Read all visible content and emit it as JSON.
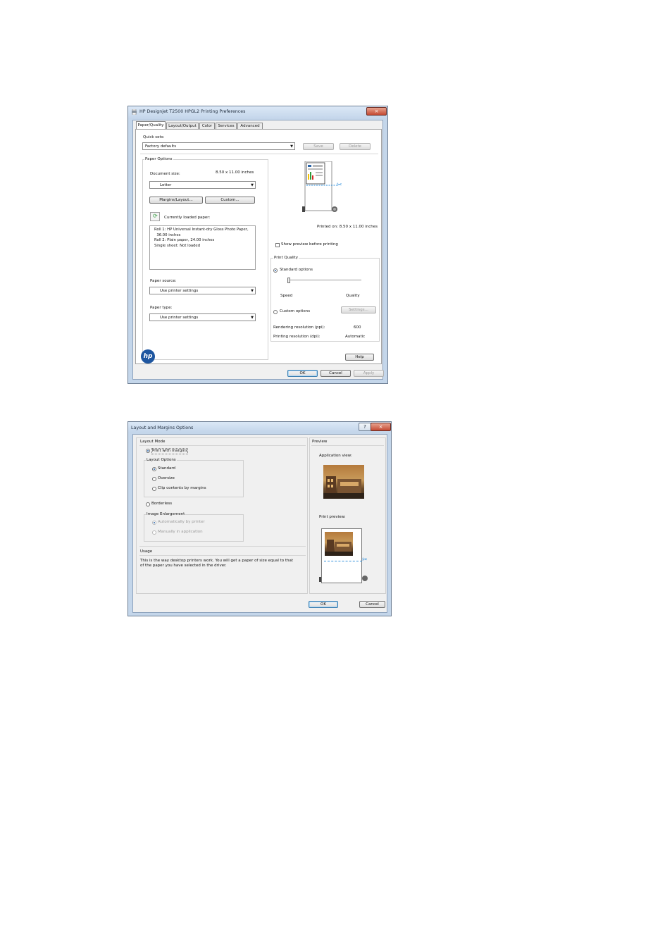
{
  "dialog1": {
    "title": "HP Designjet T2500 HPGL2 Printing Preferences",
    "close": "×",
    "tabs": [
      "Paper/Quality",
      "Layout/Output",
      "Color",
      "Services",
      "Advanced"
    ],
    "quick_sets": {
      "label": "Quick sets:",
      "value": "Factory defaults",
      "save": "Save",
      "delete": "Delete"
    },
    "paper_options": {
      "title": "Paper Options",
      "document_size_label": "Document size:",
      "document_size_value": "8.50 x 11.00 inches",
      "size_select": "Letter",
      "margins_button": "Margins/Layout...",
      "custom_button": "Custom...",
      "loaded_paper_label": "Currently loaded paper:",
      "loaded_paper_lines": [
        "Roll 1: HP Universal Instant-dry Gloss Photo Paper,",
        "  36.00 inches",
        "Roll 2: Plain paper, 24.00 inches",
        "Single sheet: Not loaded"
      ],
      "paper_source_label": "Paper source:",
      "paper_source_value": "Use printer settings",
      "paper_type_label": "Paper type:",
      "paper_type_value": "Use printer settings"
    },
    "preview": {
      "printed_on": "Printed on: 8.50 x 11.00 inches",
      "show_preview_label": "Show preview before printing"
    },
    "print_quality": {
      "title": "Print Quality",
      "standard_label": "Standard options",
      "speed": "Speed",
      "quality": "Quality",
      "custom_label": "Custom options",
      "settings_button": "Settings...",
      "rendering_label": "Rendering resolution (ppi):",
      "rendering_value": "600",
      "printing_label": "Printing resolution (dpi):",
      "printing_value": "Automatic"
    },
    "hp_logo": "hp",
    "help_button": "Help",
    "ok": "OK",
    "cancel": "Cancel",
    "apply": "Apply"
  },
  "dialog2": {
    "title": "Layout and Margins Options",
    "help": "?",
    "close": "×",
    "layout_mode_title": "Layout Mode",
    "print_with_margins": "Print with margins",
    "layout_options_title": "Layout Options",
    "standard": "Standard",
    "oversize": "Oversize",
    "clip_contents": "Clip contents by margins",
    "borderless": "Borderless",
    "image_enlargement_title": "Image Enlargement",
    "auto_by_printer": "Automatically by printer",
    "manually_in_app": "Manually in application",
    "usage_title": "Usage",
    "usage_text_1": "This is the way desktop printers work. You will get a paper of size equal to that",
    "usage_text_2": "of the paper you have selected in the driver.",
    "preview_title": "Preview",
    "application_view": "Application view:",
    "print_preview": "Print preview:",
    "ok": "OK",
    "cancel": "Cancel"
  },
  "colors": {
    "titlebar": "#c4d6ea",
    "close": "#c44a33",
    "accent": "#2a64a8",
    "cut_line": "#2e8fdc",
    "hp_blue": "#1e56a0"
  }
}
